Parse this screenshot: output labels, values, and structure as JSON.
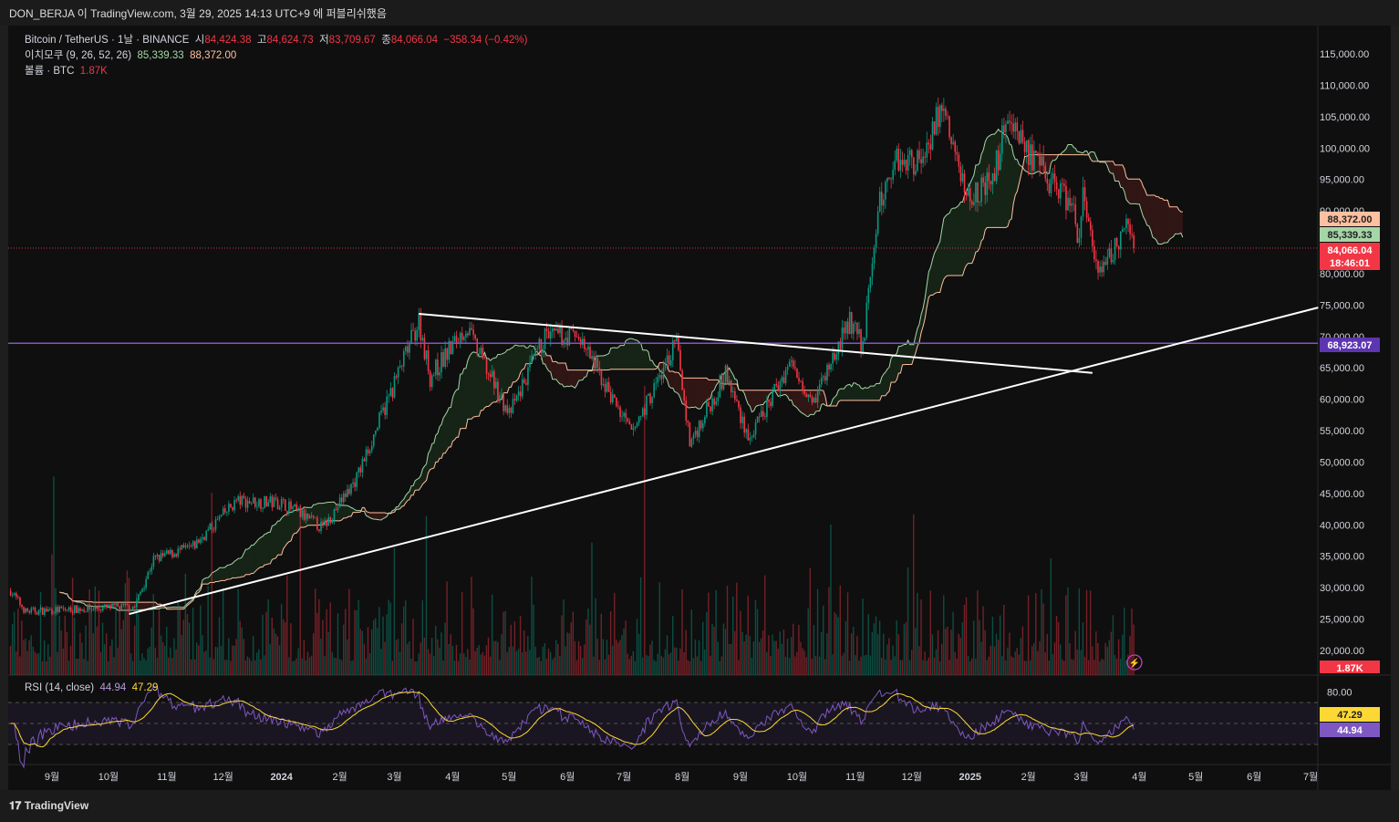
{
  "header": {
    "published": "DON_BERJA 이 TradingView.com, 3월 29, 2025 14:13 UTC+9 에 퍼블리쉬했음"
  },
  "legend": {
    "symbol": "Bitcoin / TetherUS · 1날 · BINANCE",
    "o_label": "시",
    "o": "84,424.38",
    "h_label": "고",
    "h": "84,624.73",
    "l_label": "저",
    "l": "83,709.67",
    "c_label": "종",
    "c": "84,066.04",
    "change": "−358.34 (−0.42%)",
    "ichimoku": "이치모쿠 (9, 26, 52, 26)",
    "ichi_a": "85,339.33",
    "ichi_b": "88,372.00",
    "volume": "볼륨 · BTC",
    "volume_val": "1.87K",
    "rsi": "RSI (14, close)",
    "rsi_val": "44.94",
    "rsi_ma": "47.29"
  },
  "badges": {
    "ichi_b": "88,372.00",
    "ichi_a": "85,339.33",
    "last": "84,066.04",
    "countdown": "18:46:01",
    "hline": "68,923.07",
    "vol": "1.87K",
    "rsi_ma": "47.29",
    "rsi": "44.94"
  },
  "footer": {
    "brand": "TradingView"
  },
  "colors": {
    "up": "#089981",
    "down": "#f23645",
    "hline": "#7e57c2",
    "rsi": "#7e57c2",
    "rsi_ma": "#fdd835"
  },
  "chart_data": {
    "type": "candlestick",
    "price_ticks": [
      "115,000.00",
      "110,000.00",
      "105,000.00",
      "100,000.00",
      "95,000.00",
      "90,000.00",
      "80,000.00",
      "75,000.00",
      "70,000.00",
      "65,000.00",
      "60,000.00",
      "55,000.00",
      "50,000.00",
      "45,000.00",
      "40,000.00",
      "35,000.00",
      "30,000.00",
      "25,000.00",
      "20,000.00"
    ],
    "price_tick_values": [
      115000,
      110000,
      105000,
      100000,
      95000,
      90000,
      80000,
      75000,
      70000,
      65000,
      60000,
      55000,
      50000,
      45000,
      40000,
      35000,
      30000,
      25000,
      20000
    ],
    "rsi_ticks": [
      "80.00"
    ],
    "x_ticks": [
      "9월",
      "10월",
      "11월",
      "12월",
      "2024",
      "2월",
      "3월",
      "4월",
      "5월",
      "6월",
      "7월",
      "8월",
      "9월",
      "10월",
      "11월",
      "12월",
      "2025",
      "2월",
      "3월",
      "4월",
      "5월",
      "6월",
      "7월"
    ],
    "x_tick_dates": [
      "2023-09-01",
      "2023-10-01",
      "2023-11-01",
      "2023-12-01",
      "2024-01-01",
      "2024-02-01",
      "2024-03-01",
      "2024-04-01",
      "2024-05-01",
      "2024-06-01",
      "2024-07-01",
      "2024-08-01",
      "2024-09-01",
      "2024-10-01",
      "2024-11-01",
      "2024-12-01",
      "2025-01-01",
      "2025-02-01",
      "2025-03-01",
      "2025-04-01",
      "2025-05-01",
      "2025-06-01",
      "2025-07-01"
    ],
    "close_anchors": [
      [
        "2023-08-10",
        29500
      ],
      [
        "2023-08-18",
        26200
      ],
      [
        "2023-09-15",
        26600
      ],
      [
        "2023-10-15",
        27000
      ],
      [
        "2023-10-25",
        34500
      ],
      [
        "2023-11-15",
        36500
      ],
      [
        "2023-12-08",
        43800
      ],
      [
        "2024-01-01",
        43500
      ],
      [
        "2024-01-23",
        39500
      ],
      [
        "2024-02-10",
        47500
      ],
      [
        "2024-02-28",
        61000
      ],
      [
        "2024-03-14",
        72500
      ],
      [
        "2024-03-20",
        63500
      ],
      [
        "2024-04-08",
        71500
      ],
      [
        "2024-05-01",
        57500
      ],
      [
        "2024-05-20",
        70000
      ],
      [
        "2024-06-07",
        70000
      ],
      [
        "2024-07-05",
        54500
      ],
      [
        "2024-07-29",
        69000
      ],
      [
        "2024-08-05",
        53000
      ],
      [
        "2024-08-24",
        64000
      ],
      [
        "2024-09-06",
        53500
      ],
      [
        "2024-09-27",
        65800
      ],
      [
        "2024-10-10",
        60000
      ],
      [
        "2024-10-29",
        72500
      ],
      [
        "2024-11-05",
        68500
      ],
      [
        "2024-11-13",
        90000
      ],
      [
        "2024-11-22",
        98500
      ],
      [
        "2024-12-05",
        98000
      ],
      [
        "2024-12-17",
        106500
      ],
      [
        "2024-12-30",
        92500
      ],
      [
        "2025-01-13",
        94500
      ],
      [
        "2025-01-21",
        106000
      ],
      [
        "2025-02-03",
        98000
      ],
      [
        "2025-02-24",
        91000
      ],
      [
        "2025-02-28",
        84000
      ],
      [
        "2025-03-02",
        94000
      ],
      [
        "2025-03-10",
        78500
      ],
      [
        "2025-03-24",
        87500
      ],
      [
        "2025-03-29",
        84066
      ]
    ],
    "horizontal_line": 68923.07,
    "trendlines": [
      {
        "from": [
          "2023-10-12",
          25800
        ],
        "to": [
          "2025-07-05",
          74600
        ]
      },
      {
        "from": [
          "2024-03-14",
          73600
        ],
        "to": [
          "2025-03-07",
          64200
        ]
      }
    ]
  }
}
